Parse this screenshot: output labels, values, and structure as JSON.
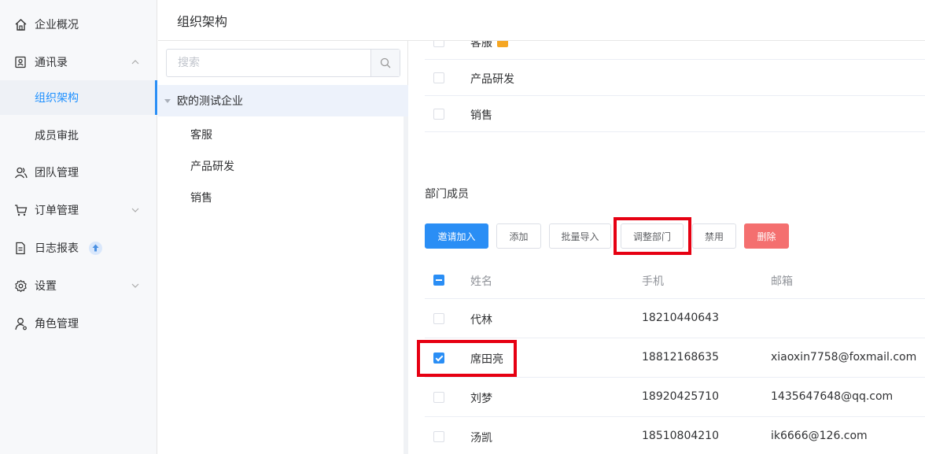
{
  "sidebar": {
    "items": [
      {
        "label": "企业概况",
        "icon": "home-icon"
      },
      {
        "label": "通讯录",
        "icon": "contacts-icon"
      },
      {
        "label": "组织架构"
      },
      {
        "label": "成员审批"
      },
      {
        "label": "团队管理",
        "icon": "team-icon"
      },
      {
        "label": "订单管理",
        "icon": "cart-icon"
      },
      {
        "label": "日志报表",
        "icon": "document-icon"
      },
      {
        "label": "设置",
        "icon": "gear-icon"
      },
      {
        "label": "角色管理",
        "icon": "user-role-icon"
      }
    ]
  },
  "header": {
    "title": "组织架构"
  },
  "tree": {
    "search_placeholder": "搜索",
    "root": "欧的测试企业",
    "children": [
      "客服",
      "产品研发",
      "销售"
    ]
  },
  "departments": [
    "客服",
    "产品研发",
    "销售"
  ],
  "members": {
    "title": "部门成员",
    "buttons": {
      "invite": "邀请加入",
      "add": "添加",
      "import": "批量导入",
      "adjust": "调整部门",
      "disable": "禁用",
      "delete": "删除"
    },
    "columns": {
      "name": "姓名",
      "phone": "手机",
      "email": "邮箱"
    },
    "rows": [
      {
        "name": "代林",
        "phone": "18210440643",
        "email": "",
        "checked": false
      },
      {
        "name": "席田亮",
        "phone": "18812168635",
        "email": "xiaoxin7758@foxmail.com",
        "checked": true
      },
      {
        "name": "刘梦",
        "phone": "18920425710",
        "email": "1435647648@qq.com",
        "checked": false
      },
      {
        "name": "汤凯",
        "phone": "18510804210",
        "email": "ik6666@126.com",
        "checked": false
      }
    ]
  },
  "colors": {
    "accent": "#2a8ef5",
    "danger": "#f46f6f",
    "highlight": "#e60012"
  }
}
